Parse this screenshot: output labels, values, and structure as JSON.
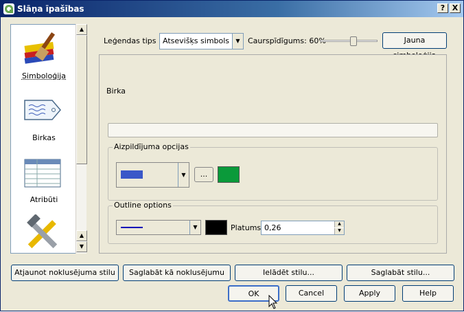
{
  "window": {
    "title": "Slāņa īpašības",
    "help_btn": "?",
    "close_btn": "X"
  },
  "sidebar": {
    "items": [
      {
        "label": "Simboloģija",
        "icon": "brush-icon"
      },
      {
        "label": "Birkas",
        "icon": "label-tag-icon"
      },
      {
        "label": "Atribūti",
        "icon": "table-icon"
      },
      {
        "label": "",
        "icon": "tools-icon"
      }
    ]
  },
  "toolbar": {
    "legend_type_label": "Leģendas tips",
    "legend_type_value": "Atsevišķs simbols",
    "transparency_label": "Caurspīdīgums: 60%",
    "transparency": 0.6,
    "new_symbology": "Jauna simboloģija"
  },
  "symbol": {
    "tag_label": "Birka",
    "tag_value": "",
    "fill_options_label": "Aizpildījuma opcijas",
    "fill_dots_btn": "...",
    "fill_style_color": "#3a57c8",
    "fill_color": "#0a9a3a",
    "outline_options_label": "Outline options",
    "outline_line_color": "#0000b8",
    "outline_color": "#000000",
    "width_label": "Platums",
    "width_value": "0,26"
  },
  "style_buttons": {
    "restore": "Atjaunot noklusējuma stilu",
    "save_default": "Saglabāt kā noklusējumu",
    "load": "Ielādēt stilu...",
    "save": "Saglabāt stilu..."
  },
  "dialog_buttons": {
    "ok": "OK",
    "cancel": "Cancel",
    "apply": "Apply",
    "help": "Help"
  }
}
